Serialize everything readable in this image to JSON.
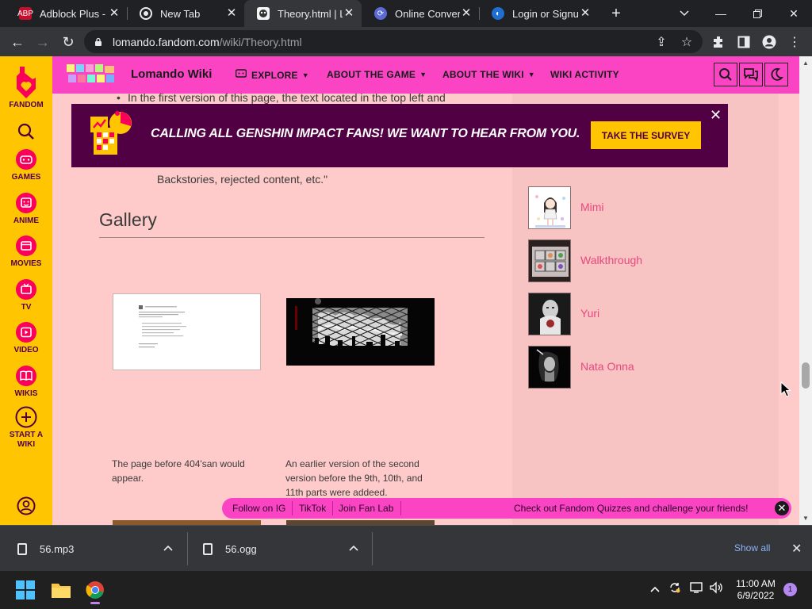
{
  "browser": {
    "tabs": [
      {
        "title": "Adblock Plus - fr",
        "active": false
      },
      {
        "title": "New Tab",
        "active": false
      },
      {
        "title": "Theory.html | Lo",
        "active": true
      },
      {
        "title": "Online Converte",
        "active": false
      },
      {
        "title": "Login or Signup",
        "active": false
      }
    ],
    "url_host": "lomando.fandom.com",
    "url_path": "/wiki/Theory.html"
  },
  "fandom_rail": {
    "brand": "FANDOM",
    "items": [
      {
        "label": "GAMES",
        "icon": "games-icon"
      },
      {
        "label": "ANIME",
        "icon": "anime-icon"
      },
      {
        "label": "MOVIES",
        "icon": "movies-icon"
      },
      {
        "label": "TV",
        "icon": "tv-icon"
      },
      {
        "label": "VIDEO",
        "icon": "video-icon"
      },
      {
        "label": "WIKIS",
        "icon": "wikis-icon"
      }
    ],
    "start_wiki_line1": "START A",
    "start_wiki_line2": "WIKI"
  },
  "wiki_header": {
    "name": "Lomando Wiki",
    "nav": [
      {
        "label": "EXPLORE",
        "has_dropdown": true
      },
      {
        "label": "ABOUT THE GAME",
        "has_dropdown": true
      },
      {
        "label": "ABOUT THE WIKI",
        "has_dropdown": true
      },
      {
        "label": "WIKI ACTIVITY",
        "has_dropdown": false
      }
    ]
  },
  "article": {
    "bullet_text": "In the first version of this page, the text located in the top left and",
    "quote_tail": "Backstories, rejected content, etc.\"",
    "gallery_heading": "Gallery",
    "captions": [
      {
        "line1": "The page before 404'san would",
        "line2": "appear."
      },
      {
        "line1": "An earlier version of the second",
        "line2": "version before the 9th, 10th, and",
        "line3": "11th parts were addeed."
      }
    ]
  },
  "sidebar": {
    "items": [
      {
        "label": "Mimi"
      },
      {
        "label": "Walkthrough"
      },
      {
        "label": "Yuri"
      },
      {
        "label": "Nata Onna"
      }
    ]
  },
  "ad": {
    "text": "CALLING ALL GENSHIN IMPACT FANS! WE WANT TO HEAR FROM YOU.",
    "button": "TAKE THE SURVEY"
  },
  "sticky_bar": {
    "links": [
      "Follow on IG",
      "TikTok",
      "Join Fan Lab"
    ],
    "promo": "Check out Fandom Quizzes and challenge your friends!"
  },
  "downloads": {
    "files": [
      {
        "name": "56.mp3"
      },
      {
        "name": "56.ogg"
      }
    ],
    "show_all": "Show all"
  },
  "taskbar": {
    "time": "11:00 AM",
    "date": "6/9/2022",
    "notifications": "1"
  },
  "colors": {
    "fandom_yellow": "#ffc500",
    "wiki_pink": "#fa44c4",
    "page_bg": "#ffcaca",
    "ad_purple": "#520044",
    "link_pink": "#e8487d"
  }
}
